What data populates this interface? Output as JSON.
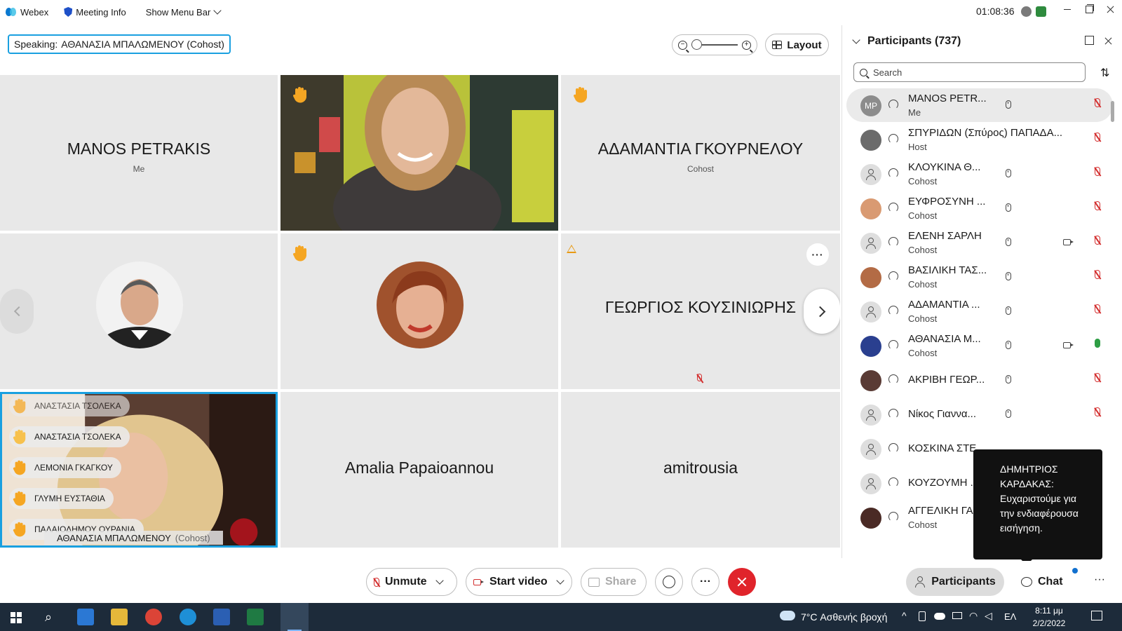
{
  "app": {
    "name": "Webex",
    "meeting_info": "Meeting Info",
    "show_menu_bar": "Show Menu Bar",
    "clock": "01:08:36"
  },
  "speaking": {
    "label": "Speaking:",
    "name": "ΑΘΑΝΑΣΙΑ ΜΠΑΛΩΜΕΝΟΥ (Cohost)"
  },
  "toolbar": {
    "layout_label": "Layout"
  },
  "tiles": [
    {
      "name": "MANOS PETRAKIS",
      "role": "Me"
    },
    {
      "name": "ΑΔΑΜΑΝΤΙΑ ΓΚΟΥΡΝΕΛΟΥ",
      "role": "Cohost"
    },
    {
      "name": "ΓΕΩΡΓΙΟΣ ΚΟΥΣΙΝΙΩΡΗΣ"
    },
    {
      "name": "Amalia Papaioannou"
    },
    {
      "name": "amitrousia"
    }
  ],
  "reactions": [
    "ΑΝΑΣΤΑΣΙΑ ΤΣΟΛΕΚΑ",
    "ΑΝΑΣΤΑΣΙΑ ΤΣΟΛΕΚΑ",
    "ΛΕΜΟΝΙΑ ΓΚΑΓΚΟΥ",
    "ΓΛΥΜΗ ΕΥΣΤΑΘΙΑ",
    "ΠΑΛΑΙΟΔΗΜΟΥ ΟΥΡΑΝΙΑ"
  ],
  "speaker_label": {
    "name": "ΑΘΑΝΑΣΙΑ ΜΠΑΛΩΜΕΝΟΥ",
    "role": "(Cohost)"
  },
  "participants": {
    "title": "Participants (737)",
    "search_placeholder": "Search",
    "list": [
      {
        "initials": "MP",
        "name": "MANOS PETR...",
        "role": "Me"
      },
      {
        "name": "ΣΠΥΡΙΔΩΝ (Σπύρος) ΠΑΠΑΔΑ...",
        "role": "Host"
      },
      {
        "name": "ΚΛΟΥΚΙΝΑ Θ...",
        "role": "Cohost"
      },
      {
        "name": "ΕΥΦΡΟΣΥΝΗ ...",
        "role": "Cohost"
      },
      {
        "name": "ΕΛΕΝΗ ΣΑΡΛΗ",
        "role": "Cohost"
      },
      {
        "name": "ΒΑΣΙΛΙΚΗ ΤΑΣ...",
        "role": "Cohost"
      },
      {
        "name": "ΑΔΑΜΑΝΤΙΑ ...",
        "role": "Cohost"
      },
      {
        "name": "ΑΘΑΝΑΣΙΑ Μ...",
        "role": "Cohost"
      },
      {
        "name": "ΑΚΡΙΒΗ ΓΕΩΡ..."
      },
      {
        "name": "Νίκος Γιαννα..."
      },
      {
        "name": "ΚΟΣΚΙΝΑ ΣΤΕ..."
      },
      {
        "name": "ΚΟΥΖΟΥΜΗ ..."
      },
      {
        "name": "ΑΓΓΕΛΙΚΗ ΓΑΡ",
        "role": "Cohost"
      }
    ]
  },
  "tooltip": "ΔΗΜΗΤΡΙΟΣ ΚΑΡΔΑΚΑΣ: Ευχαριστούμε για την ενδιαφέρουσα εισήγηση.",
  "controls": {
    "unmute": "Unmute",
    "start_video": "Start video",
    "share": "Share",
    "more": "···",
    "participants": "Participants",
    "chat": "Chat"
  },
  "taskbar": {
    "weather": "7°C  Ασθενής βροχή",
    "lang": "ΕΛ",
    "time": "8:11 μμ",
    "date": "2/2/2022"
  },
  "colors": {
    "accent": "#1aa0e0",
    "end_call": "#e0242b",
    "muted": "#d32f2f",
    "hand": "#f5a623"
  }
}
